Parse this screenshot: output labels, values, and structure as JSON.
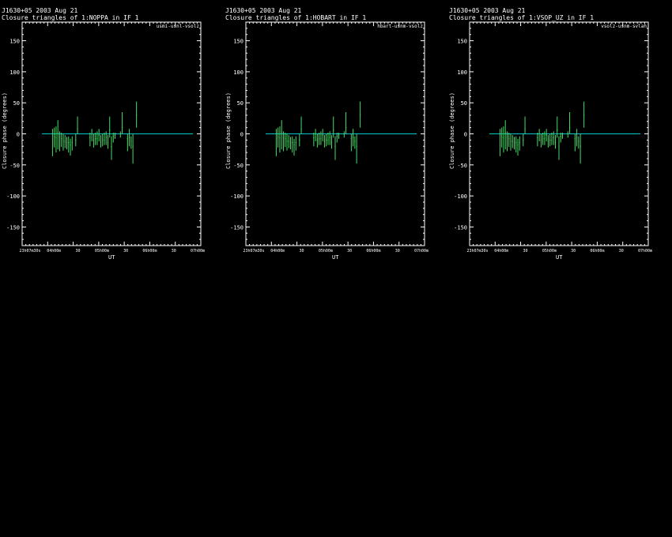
{
  "panels": [
    {
      "header1": "J1630+05  2003 Aug 21",
      "header2": "Closure triangles of 1:NOPPA in IF 1",
      "key": "usmi-usnl-vsolz"
    },
    {
      "header1": "J1630+05  2003 Aug 21",
      "header2": "Closure triangles of 1:HOBART in IF 1",
      "key": "hbart-usnm-vsolz"
    },
    {
      "header1": "J1630+05  2003 Aug 21",
      "header2": "Closure triangles of 1:VSOP_UZ in IF 1",
      "key": "vsolz-usnm-svlah"
    }
  ],
  "axes": {
    "xlabel": "UT",
    "ylabel": "Closure phase   (degrees)"
  },
  "chart_data": {
    "type": "scatter",
    "ylim": [
      -180,
      180
    ],
    "yticks": [
      150,
      100,
      50,
      0,
      -50,
      -100,
      -150
    ],
    "xticks": [
      "23h07m30s",
      "04h00m",
      "30",
      "05h00m",
      "30",
      "06h00m",
      "30",
      "07h00m"
    ],
    "model_line_color": "#00c8c8",
    "points_color": "#44dd66",
    "errorbars": [
      {
        "x": 0.17,
        "y": 0,
        "lo": -36,
        "hi": 8
      },
      {
        "x": 0.18,
        "y": -5,
        "lo": -22,
        "hi": 10
      },
      {
        "x": 0.19,
        "y": -6,
        "lo": -30,
        "hi": 12
      },
      {
        "x": 0.2,
        "y": 2,
        "lo": -25,
        "hi": 22
      },
      {
        "x": 0.21,
        "y": -5,
        "lo": -28,
        "hi": 4
      },
      {
        "x": 0.22,
        "y": -8,
        "lo": -21,
        "hi": 2
      },
      {
        "x": 0.23,
        "y": -12,
        "lo": -27,
        "hi": 0
      },
      {
        "x": 0.24,
        "y": -12,
        "lo": -23,
        "hi": -2
      },
      {
        "x": 0.25,
        "y": -14,
        "lo": -25,
        "hi": -5
      },
      {
        "x": 0.26,
        "y": -14,
        "lo": -30,
        "hi": -4
      },
      {
        "x": 0.27,
        "y": -18,
        "lo": -35,
        "hi": -8
      },
      {
        "x": 0.28,
        "y": -14,
        "lo": -27,
        "hi": -4
      },
      {
        "x": 0.3,
        "y": -10,
        "lo": -20,
        "hi": 0
      },
      {
        "x": 0.31,
        "y": 8,
        "lo": 0,
        "hi": 28
      },
      {
        "x": 0.38,
        "y": -6,
        "lo": -20,
        "hi": 2
      },
      {
        "x": 0.39,
        "y": 0,
        "lo": -12,
        "hi": 8
      },
      {
        "x": 0.4,
        "y": -10,
        "lo": -22,
        "hi": 0
      },
      {
        "x": 0.41,
        "y": -8,
        "lo": -18,
        "hi": 2
      },
      {
        "x": 0.42,
        "y": -8,
        "lo": -18,
        "hi": 4
      },
      {
        "x": 0.43,
        "y": -2,
        "lo": -12,
        "hi": 8
      },
      {
        "x": 0.44,
        "y": -12,
        "lo": -22,
        "hi": -2
      },
      {
        "x": 0.45,
        "y": -10,
        "lo": -20,
        "hi": 0
      },
      {
        "x": 0.46,
        "y": -10,
        "lo": -18,
        "hi": 2
      },
      {
        "x": 0.47,
        "y": -6,
        "lo": -18,
        "hi": 4
      },
      {
        "x": 0.48,
        "y": -14,
        "lo": -24,
        "hi": -2
      },
      {
        "x": 0.49,
        "y": 6,
        "lo": -6,
        "hi": 28
      },
      {
        "x": 0.5,
        "y": -20,
        "lo": -42,
        "hi": -4
      },
      {
        "x": 0.51,
        "y": -4,
        "lo": -14,
        "hi": 2
      },
      {
        "x": 0.52,
        "y": -2,
        "lo": -8,
        "hi": 2
      },
      {
        "x": 0.55,
        "y": 0,
        "lo": -6,
        "hi": 4
      },
      {
        "x": 0.56,
        "y": 10,
        "lo": 0,
        "hi": 35
      },
      {
        "x": 0.59,
        "y": -8,
        "lo": -28,
        "hi": 0
      },
      {
        "x": 0.6,
        "y": -6,
        "lo": -20,
        "hi": 8
      },
      {
        "x": 0.61,
        "y": -12,
        "lo": -24,
        "hi": -4
      },
      {
        "x": 0.62,
        "y": -20,
        "lo": -48,
        "hi": 0
      },
      {
        "x": 0.64,
        "y": 30,
        "lo": 10,
        "hi": 52
      }
    ]
  }
}
